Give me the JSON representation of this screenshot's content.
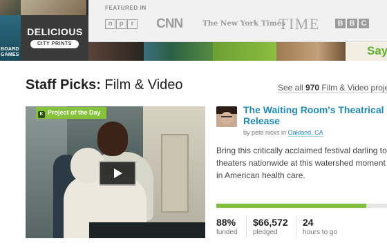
{
  "banner": {
    "featured_in_label": "FEATURED IN",
    "logos": {
      "npr_letters": [
        "n",
        "p",
        "r"
      ],
      "cnn": "CNN",
      "nyt": "The New York Times",
      "time": "TIME",
      "bbc_letters": [
        "B",
        "B",
        "C"
      ]
    },
    "tiles": {
      "delicious_title": "DELICIOUS",
      "delicious_sub": "CITY PRINTS",
      "board_text_1": "BOARD",
      "board_text_2": "GAMES",
      "say_text": "Say"
    }
  },
  "staff_picks": {
    "heading_bold": "Staff Picks:",
    "heading_category": "Film & Video",
    "see_all_prefix": "See all",
    "see_all_count": "970",
    "see_all_suffix": "Film & Video projects"
  },
  "project": {
    "badge_icon_letter": "K",
    "badge_label": "Project of the Day",
    "title": "The Waiting Room's Theatrical Release",
    "by_prefix": "by pete nicks in",
    "location": "Oakland, CA",
    "description": "Bring this critically acclaimed festival darling to theaters nationwide at this watershed moment in American health care.",
    "progress_fraction": 0.88,
    "stats": {
      "funded_value": "88%",
      "funded_label": "funded",
      "pledged_value": "$66,572",
      "pledged_label": "pledged",
      "hours_value": "24",
      "hours_label": "hours to go"
    }
  },
  "colors": {
    "link_blue": "#1e8ab5",
    "progress_green": "#7fbf3e",
    "badge_green": "#86c23a"
  },
  "icons": {
    "play": "play-icon",
    "avatar": "creator-avatar"
  }
}
